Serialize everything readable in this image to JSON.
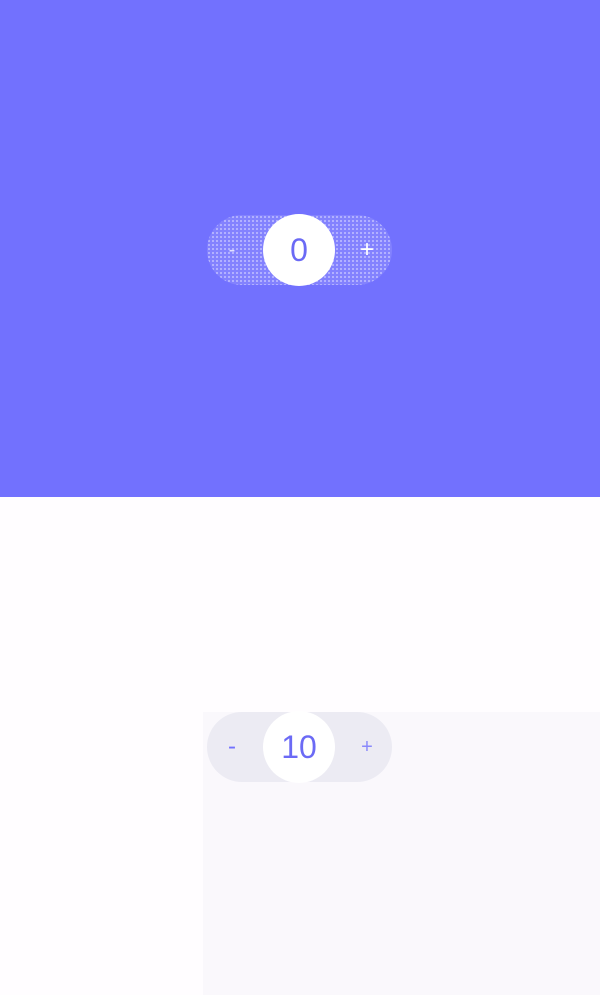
{
  "top_panel": {
    "background_color": "#7271fe",
    "stepper": {
      "decrement_label": "-",
      "value": "0",
      "increment_label": "+"
    }
  },
  "bottom_panel": {
    "background_color": "#fffdff",
    "stepper": {
      "decrement_label": "-",
      "value": "10",
      "increment_label": "+"
    }
  },
  "colors": {
    "accent": "#7271fe",
    "track_light": "#ecebf3",
    "value_circle": "#ffffff"
  }
}
